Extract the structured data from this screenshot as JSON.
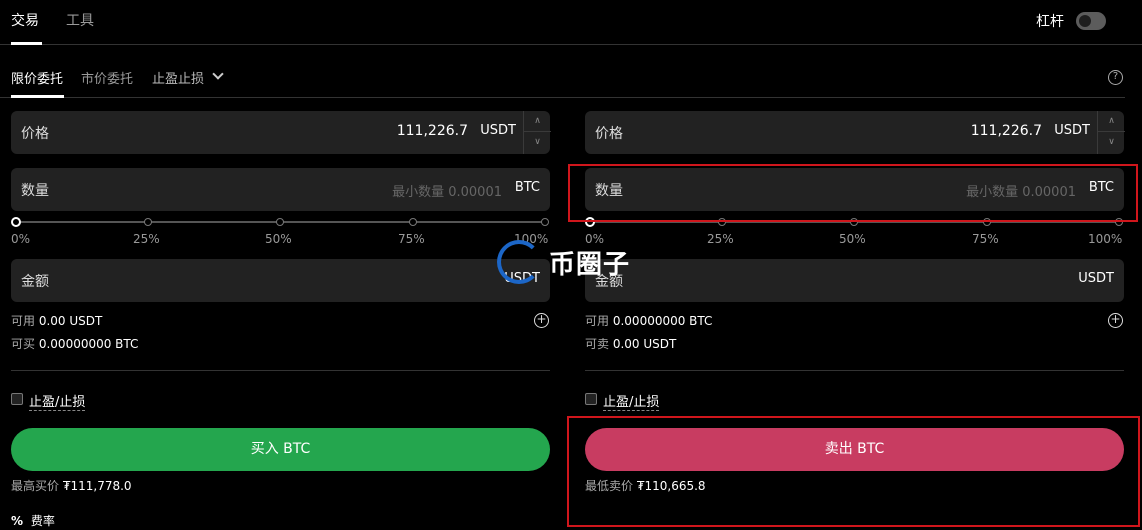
{
  "top_tabs": [
    {
      "label": "交易",
      "active": true
    },
    {
      "label": "工具",
      "active": false
    }
  ],
  "leverage": {
    "label": "杠杆",
    "enabled": false
  },
  "order_tabs": [
    {
      "label": "限价委托",
      "active": true
    },
    {
      "label": "市价委托",
      "active": false
    },
    {
      "label": "止盈止损",
      "active": false
    }
  ],
  "help_icon": "help-icon",
  "buy": {
    "price_label": "价格",
    "price_value": "111,226.7",
    "price_unit": "USDT",
    "qty_label": "数量",
    "qty_placeholder": "最小数量 0.00001",
    "qty_unit": "BTC",
    "amount_label": "金额",
    "amount_unit": "USDT",
    "slider_labels": [
      "0%",
      "25%",
      "50%",
      "75%",
      "100%"
    ],
    "avail_label": "可用",
    "avail_value": "0.00 USDT",
    "can_label": "可买",
    "can_value": "0.00000000 BTC",
    "tpsl_label": "止盈/止损",
    "button": "买入 BTC",
    "best_label": "最高买价",
    "best_value": "₮111,778.0"
  },
  "sell": {
    "price_label": "价格",
    "price_value": "111,226.7",
    "price_unit": "USDT",
    "qty_label": "数量",
    "qty_placeholder": "最小数量 0.00001",
    "qty_unit": "BTC",
    "amount_label": "金额",
    "amount_unit": "USDT",
    "slider_labels": [
      "0%",
      "25%",
      "50%",
      "75%",
      "100%"
    ],
    "avail_label": "可用",
    "avail_value": "0.00000000 BTC",
    "can_label": "可卖",
    "can_value": "0.00 USDT",
    "tpsl_label": "止盈/止损",
    "button": "卖出 BTC",
    "best_label": "最低卖价",
    "best_value": "₮110,665.8"
  },
  "fee": {
    "icon": "%",
    "label": "费率"
  },
  "watermark": "币圈子",
  "colors": {
    "buy": "#24a64e",
    "sell": "#c83c61",
    "highlight": "#d0161c",
    "watermark": "#1c66c7"
  }
}
